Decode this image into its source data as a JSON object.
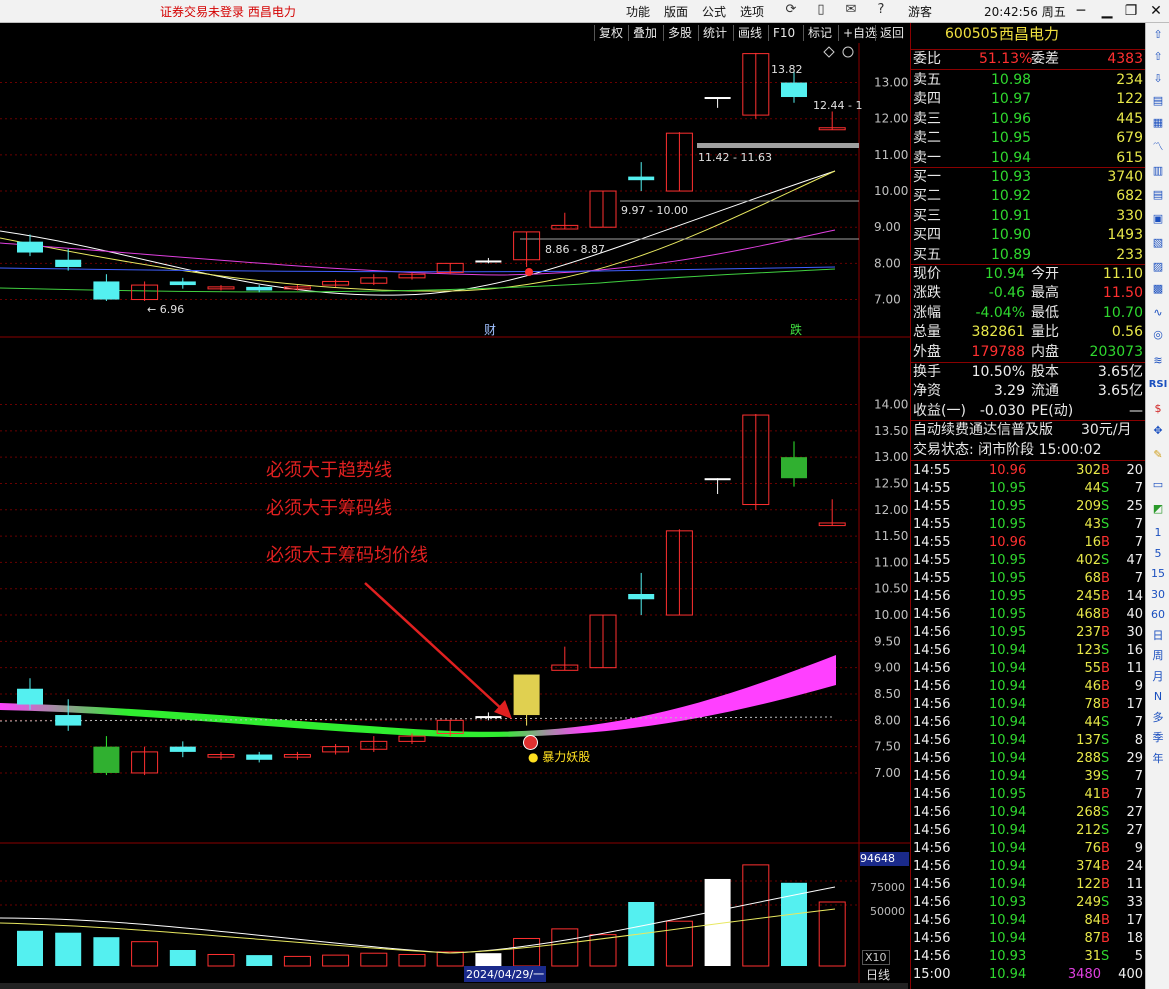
{
  "topbar": {
    "warning": "证券交易未登录  西昌电力",
    "menus": [
      "功能",
      "版面",
      "公式",
      "选项"
    ],
    "user": "游客",
    "clock": "20:42:56 周五"
  },
  "toolbar": [
    "复权",
    "叠加",
    "多股",
    "统计",
    "画线",
    "F10",
    "标记",
    "+自选",
    "返回"
  ],
  "main_chart": {
    "y_labels": [
      "13.00",
      "12.00",
      "11.00",
      "10.00",
      "9.00",
      "8.00",
      "7.00"
    ],
    "price_labels": {
      "high": "13.82",
      "range1": "12.44 - 1",
      "range2": "11.42 - 11.63",
      "range3": "9.97 - 10.00",
      "range4": "8.86 - 8.87",
      "low": "6.96"
    },
    "markers": {
      "cai": "财",
      "die": "跌"
    },
    "chart_data": {
      "type": "candlestick",
      "ylim": [
        6.6,
        13.9
      ],
      "candles": [
        {
          "o": 8.6,
          "c": 8.3,
          "h": 8.8,
          "l": 8.2,
          "color": "cyan"
        },
        {
          "o": 8.1,
          "c": 7.9,
          "h": 8.4,
          "l": 7.8,
          "color": "cyan"
        },
        {
          "o": 7.5,
          "c": 7.0,
          "h": 7.7,
          "l": 6.96,
          "color": "cyan"
        },
        {
          "o": 7.0,
          "c": 7.4,
          "h": 7.5,
          "l": 6.96,
          "color": "red"
        },
        {
          "o": 7.5,
          "c": 7.4,
          "h": 7.6,
          "l": 7.3,
          "color": "cyan"
        },
        {
          "o": 7.3,
          "c": 7.35,
          "h": 7.4,
          "l": 7.25,
          "color": "red"
        },
        {
          "o": 7.35,
          "c": 7.25,
          "h": 7.4,
          "l": 7.2,
          "color": "cyan"
        },
        {
          "o": 7.3,
          "c": 7.35,
          "h": 7.4,
          "l": 7.25,
          "color": "red"
        },
        {
          "o": 7.4,
          "c": 7.5,
          "h": 7.55,
          "l": 7.35,
          "color": "red"
        },
        {
          "o": 7.45,
          "c": 7.6,
          "h": 7.7,
          "l": 7.4,
          "color": "red"
        },
        {
          "o": 7.6,
          "c": 7.7,
          "h": 7.75,
          "l": 7.55,
          "color": "red"
        },
        {
          "o": 7.75,
          "c": 8.0,
          "h": 8.0,
          "l": 7.7,
          "color": "red"
        },
        {
          "o": 8.08,
          "c": 8.08,
          "h": 8.15,
          "l": 8.0,
          "color": "white"
        },
        {
          "o": 8.1,
          "c": 8.87,
          "h": 8.87,
          "l": 7.9,
          "color": "red"
        },
        {
          "o": 8.95,
          "c": 9.05,
          "h": 9.4,
          "l": 8.95,
          "color": "red"
        },
        {
          "o": 9.0,
          "c": 10.0,
          "h": 10.0,
          "l": 9.0,
          "color": "red"
        },
        {
          "o": 10.3,
          "c": 10.4,
          "h": 10.8,
          "l": 10.0,
          "color": "cyan"
        },
        {
          "o": 10.0,
          "c": 11.6,
          "h": 11.63,
          "l": 10.0,
          "color": "red"
        },
        {
          "o": 12.6,
          "c": 12.6,
          "h": 12.6,
          "l": 12.3,
          "color": "white"
        },
        {
          "o": 12.1,
          "c": 13.8,
          "h": 13.82,
          "l": 12.0,
          "color": "red"
        },
        {
          "o": 13.0,
          "c": 12.6,
          "h": 13.3,
          "l": 12.44,
          "color": "cyan"
        },
        {
          "o": 11.7,
          "c": 11.75,
          "h": 12.2,
          "l": 11.7,
          "color": "red"
        }
      ]
    }
  },
  "mid_chart": {
    "y_labels": [
      "14.00",
      "13.50",
      "13.00",
      "12.50",
      "12.00",
      "11.50",
      "11.00",
      "10.50",
      "10.00",
      "9.50",
      "9.00",
      "8.50",
      "8.00",
      "7.50",
      "7.00"
    ],
    "annotations": [
      "必须大于趋势线",
      "必须大于筹码线",
      "必须大于筹码均价线"
    ],
    "signal": "暴力妖股"
  },
  "vol_chart": {
    "y_labels": [
      "94648",
      "75000",
      "50000"
    ],
    "date_label": "2024/04/29/一",
    "x10": "X10",
    "period": "日线"
  },
  "right_panel": {
    "code": "600505",
    "name": "西昌电力",
    "weibi_label": "委比",
    "weibi": "51.13%",
    "weicha_label": "委差",
    "weicha": "4383",
    "sells": [
      {
        "label": "卖五",
        "price": "10.98",
        "vol": "234"
      },
      {
        "label": "卖四",
        "price": "10.97",
        "vol": "122"
      },
      {
        "label": "卖三",
        "price": "10.96",
        "vol": "445"
      },
      {
        "label": "卖二",
        "price": "10.95",
        "vol": "679"
      },
      {
        "label": "卖一",
        "price": "10.94",
        "vol": "615"
      }
    ],
    "buys": [
      {
        "label": "买一",
        "price": "10.93",
        "vol": "3740"
      },
      {
        "label": "买二",
        "price": "10.92",
        "vol": "682"
      },
      {
        "label": "买三",
        "price": "10.91",
        "vol": "330"
      },
      {
        "label": "买四",
        "price": "10.90",
        "vol": "1493"
      },
      {
        "label": "买五",
        "price": "10.89",
        "vol": "233"
      }
    ],
    "stats": [
      {
        "l1": "现价",
        "v1": "10.94",
        "c1": "green",
        "l2": "今开",
        "v2": "11.10",
        "c2": "yellow"
      },
      {
        "l1": "涨跌",
        "v1": "-0.46",
        "c1": "green",
        "l2": "最高",
        "v2": "11.50",
        "c2": "red"
      },
      {
        "l1": "涨幅",
        "v1": "-4.04%",
        "c1": "green",
        "l2": "最低",
        "v2": "10.70",
        "c2": "green"
      },
      {
        "l1": "总量",
        "v1": "382861",
        "c1": "yellow",
        "l2": "量比",
        "v2": "0.56",
        "c2": "yellow"
      },
      {
        "l1": "外盘",
        "v1": "179788",
        "c1": "red",
        "l2": "内盘",
        "v2": "203073",
        "c2": "green"
      }
    ],
    "stats2": [
      {
        "l1": "换手",
        "v1": "10.50%",
        "l2": "股本",
        "v2": "3.65亿"
      },
      {
        "l1": "净资",
        "v1": "3.29",
        "l2": "流通",
        "v2": "3.65亿"
      },
      {
        "l1": "收益(一)",
        "v1": "-0.030",
        "l2": "PE(动)",
        "v2": "—"
      }
    ],
    "promo": "自动续费通达信普及版",
    "promo_price": "30元/月",
    "trade_status": "交易状态: 闭市阶段 15:00:02",
    "ticks": [
      {
        "t": "14:55",
        "p": "10.96",
        "pc": "red",
        "v": "302",
        "bs": "B",
        "n": "20"
      },
      {
        "t": "14:55",
        "p": "10.95",
        "pc": "green",
        "v": "44",
        "bs": "S",
        "n": "7"
      },
      {
        "t": "14:55",
        "p": "10.95",
        "pc": "green",
        "v": "209",
        "bs": "S",
        "n": "25"
      },
      {
        "t": "14:55",
        "p": "10.95",
        "pc": "green",
        "v": "43",
        "bs": "S",
        "n": "7"
      },
      {
        "t": "14:55",
        "p": "10.96",
        "pc": "red",
        "v": "16",
        "bs": "B",
        "n": "7"
      },
      {
        "t": "14:55",
        "p": "10.95",
        "pc": "green",
        "v": "402",
        "bs": "S",
        "n": "47"
      },
      {
        "t": "14:55",
        "p": "10.95",
        "pc": "green",
        "v": "68",
        "bs": "B",
        "n": "7"
      },
      {
        "t": "14:56",
        "p": "10.95",
        "pc": "green",
        "v": "245",
        "bs": "B",
        "n": "14"
      },
      {
        "t": "14:56",
        "p": "10.95",
        "pc": "green",
        "v": "468",
        "bs": "B",
        "n": "40"
      },
      {
        "t": "14:56",
        "p": "10.95",
        "pc": "green",
        "v": "237",
        "bs": "B",
        "n": "30"
      },
      {
        "t": "14:56",
        "p": "10.94",
        "pc": "green",
        "v": "123",
        "bs": "S",
        "n": "16"
      },
      {
        "t": "14:56",
        "p": "10.94",
        "pc": "green",
        "v": "55",
        "bs": "B",
        "n": "11"
      },
      {
        "t": "14:56",
        "p": "10.94",
        "pc": "green",
        "v": "46",
        "bs": "B",
        "n": "9"
      },
      {
        "t": "14:56",
        "p": "10.94",
        "pc": "green",
        "v": "78",
        "bs": "B",
        "n": "17"
      },
      {
        "t": "14:56",
        "p": "10.94",
        "pc": "green",
        "v": "44",
        "bs": "S",
        "n": "7"
      },
      {
        "t": "14:56",
        "p": "10.94",
        "pc": "green",
        "v": "137",
        "bs": "S",
        "n": "8"
      },
      {
        "t": "14:56",
        "p": "10.94",
        "pc": "green",
        "v": "288",
        "bs": "S",
        "n": "29"
      },
      {
        "t": "14:56",
        "p": "10.94",
        "pc": "green",
        "v": "39",
        "bs": "S",
        "n": "7"
      },
      {
        "t": "14:56",
        "p": "10.95",
        "pc": "green",
        "v": "41",
        "bs": "B",
        "n": "7"
      },
      {
        "t": "14:56",
        "p": "10.94",
        "pc": "green",
        "v": "268",
        "bs": "S",
        "n": "27"
      },
      {
        "t": "14:56",
        "p": "10.94",
        "pc": "green",
        "v": "212",
        "bs": "S",
        "n": "27"
      },
      {
        "t": "14:56",
        "p": "10.94",
        "pc": "green",
        "v": "76",
        "bs": "B",
        "n": "9"
      },
      {
        "t": "14:56",
        "p": "10.94",
        "pc": "green",
        "v": "374",
        "bs": "B",
        "n": "24"
      },
      {
        "t": "14:56",
        "p": "10.94",
        "pc": "green",
        "v": "122",
        "bs": "B",
        "n": "11"
      },
      {
        "t": "14:56",
        "p": "10.93",
        "pc": "green",
        "v": "249",
        "bs": "S",
        "n": "33"
      },
      {
        "t": "14:56",
        "p": "10.94",
        "pc": "green",
        "v": "84",
        "bs": "B",
        "n": "17"
      },
      {
        "t": "14:56",
        "p": "10.94",
        "pc": "green",
        "v": "87",
        "bs": "B",
        "n": "18"
      },
      {
        "t": "14:56",
        "p": "10.93",
        "pc": "green",
        "v": "31",
        "bs": "S",
        "n": "5"
      },
      {
        "t": "15:00",
        "p": "10.94",
        "pc": "green",
        "v": "3480",
        "bs": "",
        "n": "400"
      }
    ]
  },
  "side_icons": [
    "1",
    "5",
    "15",
    "30",
    "60",
    "日",
    "周",
    "月",
    "N",
    "多",
    "季",
    "年"
  ]
}
